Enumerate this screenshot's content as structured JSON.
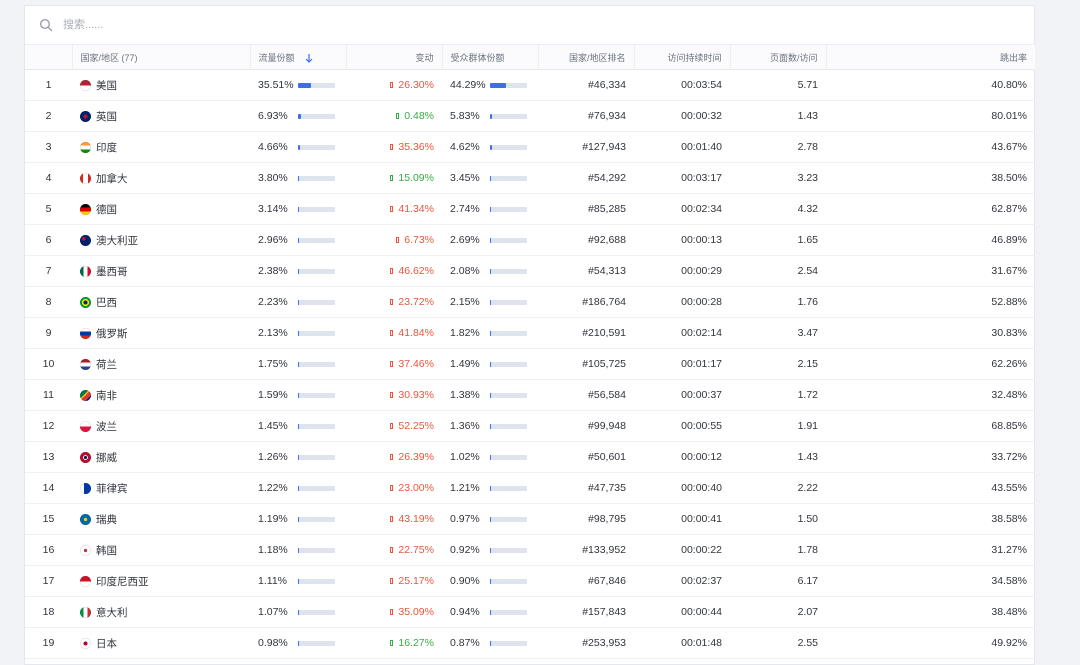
{
  "search": {
    "placeholder": "搜索......"
  },
  "colors": {
    "up": "#3bab47",
    "down": "#e8573c",
    "bar_fill": "#3d6fe6",
    "bar_track": "#dfe3ee"
  },
  "table": {
    "headers": {
      "country": "国家/地区 (77)",
      "traffic_share": "流量份额",
      "change": "变动",
      "audience_share": "受众群体份额",
      "country_rank": "国家/地区排名",
      "duration": "访问持续时间",
      "pages": "页面数/访问",
      "bounce": "跳出率"
    },
    "rows": [
      {
        "rank": "1",
        "country": "美国",
        "flag": "us",
        "share": "35.51%",
        "share_value": 35.51,
        "change": "26.30%",
        "dir": "down",
        "audience": "44.29%",
        "audience_value": 44.29,
        "crank": "#46,334",
        "duration": "00:03:54",
        "pages": "5.71",
        "bounce": "40.80%"
      },
      {
        "rank": "2",
        "country": "英国",
        "flag": "gb",
        "share": "6.93%",
        "share_value": 6.93,
        "change": "0.48%",
        "dir": "up",
        "audience": "5.83%",
        "audience_value": 5.83,
        "crank": "#76,934",
        "duration": "00:00:32",
        "pages": "1.43",
        "bounce": "80.01%"
      },
      {
        "rank": "3",
        "country": "印度",
        "flag": "in",
        "share": "4.66%",
        "share_value": 4.66,
        "change": "35.36%",
        "dir": "down",
        "audience": "4.62%",
        "audience_value": 4.62,
        "crank": "#127,943",
        "duration": "00:01:40",
        "pages": "2.78",
        "bounce": "43.67%"
      },
      {
        "rank": "4",
        "country": "加拿大",
        "flag": "ca",
        "share": "3.80%",
        "share_value": 3.8,
        "change": "15.09%",
        "dir": "up",
        "audience": "3.45%",
        "audience_value": 3.45,
        "crank": "#54,292",
        "duration": "00:03:17",
        "pages": "3.23",
        "bounce": "38.50%"
      },
      {
        "rank": "5",
        "country": "德国",
        "flag": "de",
        "share": "3.14%",
        "share_value": 3.14,
        "change": "41.34%",
        "dir": "down",
        "audience": "2.74%",
        "audience_value": 2.74,
        "crank": "#85,285",
        "duration": "00:02:34",
        "pages": "4.32",
        "bounce": "62.87%"
      },
      {
        "rank": "6",
        "country": "澳大利亚",
        "flag": "au",
        "share": "2.96%",
        "share_value": 2.96,
        "change": "6.73%",
        "dir": "down",
        "audience": "2.69%",
        "audience_value": 2.69,
        "crank": "#92,688",
        "duration": "00:00:13",
        "pages": "1.65",
        "bounce": "46.89%"
      },
      {
        "rank": "7",
        "country": "墨西哥",
        "flag": "mx",
        "share": "2.38%",
        "share_value": 2.38,
        "change": "46.62%",
        "dir": "down",
        "audience": "2.08%",
        "audience_value": 2.08,
        "crank": "#54,313",
        "duration": "00:00:29",
        "pages": "2.54",
        "bounce": "31.67%"
      },
      {
        "rank": "8",
        "country": "巴西",
        "flag": "br",
        "share": "2.23%",
        "share_value": 2.23,
        "change": "23.72%",
        "dir": "down",
        "audience": "2.15%",
        "audience_value": 2.15,
        "crank": "#186,764",
        "duration": "00:00:28",
        "pages": "1.76",
        "bounce": "52.88%"
      },
      {
        "rank": "9",
        "country": "俄罗斯",
        "flag": "ru",
        "share": "2.13%",
        "share_value": 2.13,
        "change": "41.84%",
        "dir": "down",
        "audience": "1.82%",
        "audience_value": 1.82,
        "crank": "#210,591",
        "duration": "00:02:14",
        "pages": "3.47",
        "bounce": "30.83%"
      },
      {
        "rank": "10",
        "country": "荷兰",
        "flag": "nl",
        "share": "1.75%",
        "share_value": 1.75,
        "change": "37.46%",
        "dir": "down",
        "audience": "1.49%",
        "audience_value": 1.49,
        "crank": "#105,725",
        "duration": "00:01:17",
        "pages": "2.15",
        "bounce": "62.26%"
      },
      {
        "rank": "11",
        "country": "南非",
        "flag": "za",
        "share": "1.59%",
        "share_value": 1.59,
        "change": "30.93%",
        "dir": "down",
        "audience": "1.38%",
        "audience_value": 1.38,
        "crank": "#56,584",
        "duration": "00:00:37",
        "pages": "1.72",
        "bounce": "32.48%"
      },
      {
        "rank": "12",
        "country": "波兰",
        "flag": "pl",
        "share": "1.45%",
        "share_value": 1.45,
        "change": "52.25%",
        "dir": "down",
        "audience": "1.36%",
        "audience_value": 1.36,
        "crank": "#99,948",
        "duration": "00:00:55",
        "pages": "1.91",
        "bounce": "68.85%"
      },
      {
        "rank": "13",
        "country": "挪威",
        "flag": "no",
        "share": "1.26%",
        "share_value": 1.26,
        "change": "26.39%",
        "dir": "down",
        "audience": "1.02%",
        "audience_value": 1.02,
        "crank": "#50,601",
        "duration": "00:00:12",
        "pages": "1.43",
        "bounce": "33.72%"
      },
      {
        "rank": "14",
        "country": "菲律宾",
        "flag": "ph",
        "share": "1.22%",
        "share_value": 1.22,
        "change": "23.00%",
        "dir": "down",
        "audience": "1.21%",
        "audience_value": 1.21,
        "crank": "#47,735",
        "duration": "00:00:40",
        "pages": "2.22",
        "bounce": "43.55%"
      },
      {
        "rank": "15",
        "country": "瑞典",
        "flag": "se",
        "share": "1.19%",
        "share_value": 1.19,
        "change": "43.19%",
        "dir": "down",
        "audience": "0.97%",
        "audience_value": 0.97,
        "crank": "#98,795",
        "duration": "00:00:41",
        "pages": "1.50",
        "bounce": "38.58%"
      },
      {
        "rank": "16",
        "country": "韩国",
        "flag": "kr",
        "share": "1.18%",
        "share_value": 1.18,
        "change": "22.75%",
        "dir": "down",
        "audience": "0.92%",
        "audience_value": 0.92,
        "crank": "#133,952",
        "duration": "00:00:22",
        "pages": "1.78",
        "bounce": "31.27%"
      },
      {
        "rank": "17",
        "country": "印度尼西亚",
        "flag": "id",
        "share": "1.11%",
        "share_value": 1.11,
        "change": "25.17%",
        "dir": "down",
        "audience": "0.90%",
        "audience_value": 0.9,
        "crank": "#67,846",
        "duration": "00:02:37",
        "pages": "6.17",
        "bounce": "34.58%"
      },
      {
        "rank": "18",
        "country": "意大利",
        "flag": "it",
        "share": "1.07%",
        "share_value": 1.07,
        "change": "35.09%",
        "dir": "down",
        "audience": "0.94%",
        "audience_value": 0.94,
        "crank": "#157,843",
        "duration": "00:00:44",
        "pages": "2.07",
        "bounce": "38.48%"
      },
      {
        "rank": "19",
        "country": "日本",
        "flag": "jp",
        "share": "0.98%",
        "share_value": 0.98,
        "change": "16.27%",
        "dir": "up",
        "audience": "0.87%",
        "audience_value": 0.87,
        "crank": "#253,953",
        "duration": "00:01:48",
        "pages": "2.55",
        "bounce": "49.92%"
      }
    ]
  }
}
